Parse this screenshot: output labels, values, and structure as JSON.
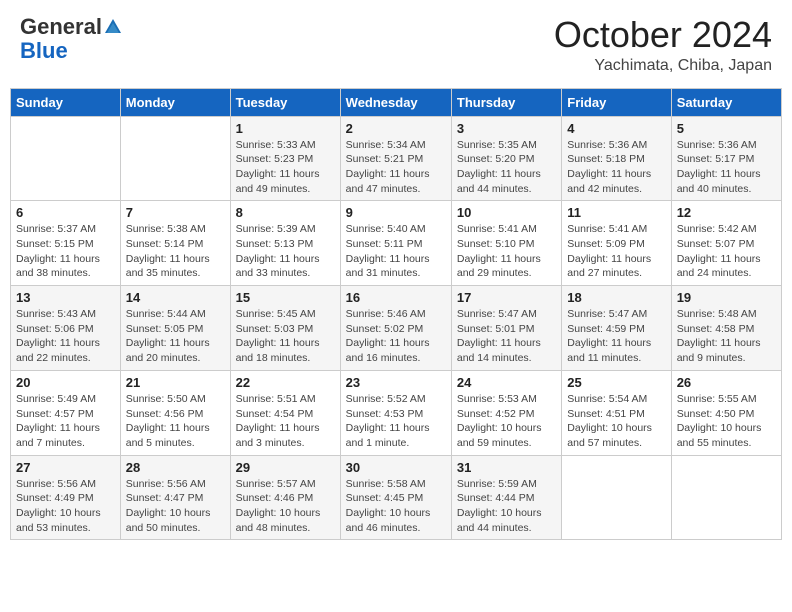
{
  "header": {
    "logo_general": "General",
    "logo_blue": "Blue",
    "month": "October 2024",
    "location": "Yachimata, Chiba, Japan"
  },
  "weekdays": [
    "Sunday",
    "Monday",
    "Tuesday",
    "Wednesday",
    "Thursday",
    "Friday",
    "Saturday"
  ],
  "weeks": [
    [
      {
        "day": "",
        "info": ""
      },
      {
        "day": "",
        "info": ""
      },
      {
        "day": "1",
        "info": "Sunrise: 5:33 AM\nSunset: 5:23 PM\nDaylight: 11 hours and 49 minutes."
      },
      {
        "day": "2",
        "info": "Sunrise: 5:34 AM\nSunset: 5:21 PM\nDaylight: 11 hours and 47 minutes."
      },
      {
        "day": "3",
        "info": "Sunrise: 5:35 AM\nSunset: 5:20 PM\nDaylight: 11 hours and 44 minutes."
      },
      {
        "day": "4",
        "info": "Sunrise: 5:36 AM\nSunset: 5:18 PM\nDaylight: 11 hours and 42 minutes."
      },
      {
        "day": "5",
        "info": "Sunrise: 5:36 AM\nSunset: 5:17 PM\nDaylight: 11 hours and 40 minutes."
      }
    ],
    [
      {
        "day": "6",
        "info": "Sunrise: 5:37 AM\nSunset: 5:15 PM\nDaylight: 11 hours and 38 minutes."
      },
      {
        "day": "7",
        "info": "Sunrise: 5:38 AM\nSunset: 5:14 PM\nDaylight: 11 hours and 35 minutes."
      },
      {
        "day": "8",
        "info": "Sunrise: 5:39 AM\nSunset: 5:13 PM\nDaylight: 11 hours and 33 minutes."
      },
      {
        "day": "9",
        "info": "Sunrise: 5:40 AM\nSunset: 5:11 PM\nDaylight: 11 hours and 31 minutes."
      },
      {
        "day": "10",
        "info": "Sunrise: 5:41 AM\nSunset: 5:10 PM\nDaylight: 11 hours and 29 minutes."
      },
      {
        "day": "11",
        "info": "Sunrise: 5:41 AM\nSunset: 5:09 PM\nDaylight: 11 hours and 27 minutes."
      },
      {
        "day": "12",
        "info": "Sunrise: 5:42 AM\nSunset: 5:07 PM\nDaylight: 11 hours and 24 minutes."
      }
    ],
    [
      {
        "day": "13",
        "info": "Sunrise: 5:43 AM\nSunset: 5:06 PM\nDaylight: 11 hours and 22 minutes."
      },
      {
        "day": "14",
        "info": "Sunrise: 5:44 AM\nSunset: 5:05 PM\nDaylight: 11 hours and 20 minutes."
      },
      {
        "day": "15",
        "info": "Sunrise: 5:45 AM\nSunset: 5:03 PM\nDaylight: 11 hours and 18 minutes."
      },
      {
        "day": "16",
        "info": "Sunrise: 5:46 AM\nSunset: 5:02 PM\nDaylight: 11 hours and 16 minutes."
      },
      {
        "day": "17",
        "info": "Sunrise: 5:47 AM\nSunset: 5:01 PM\nDaylight: 11 hours and 14 minutes."
      },
      {
        "day": "18",
        "info": "Sunrise: 5:47 AM\nSunset: 4:59 PM\nDaylight: 11 hours and 11 minutes."
      },
      {
        "day": "19",
        "info": "Sunrise: 5:48 AM\nSunset: 4:58 PM\nDaylight: 11 hours and 9 minutes."
      }
    ],
    [
      {
        "day": "20",
        "info": "Sunrise: 5:49 AM\nSunset: 4:57 PM\nDaylight: 11 hours and 7 minutes."
      },
      {
        "day": "21",
        "info": "Sunrise: 5:50 AM\nSunset: 4:56 PM\nDaylight: 11 hours and 5 minutes."
      },
      {
        "day": "22",
        "info": "Sunrise: 5:51 AM\nSunset: 4:54 PM\nDaylight: 11 hours and 3 minutes."
      },
      {
        "day": "23",
        "info": "Sunrise: 5:52 AM\nSunset: 4:53 PM\nDaylight: 11 hours and 1 minute."
      },
      {
        "day": "24",
        "info": "Sunrise: 5:53 AM\nSunset: 4:52 PM\nDaylight: 10 hours and 59 minutes."
      },
      {
        "day": "25",
        "info": "Sunrise: 5:54 AM\nSunset: 4:51 PM\nDaylight: 10 hours and 57 minutes."
      },
      {
        "day": "26",
        "info": "Sunrise: 5:55 AM\nSunset: 4:50 PM\nDaylight: 10 hours and 55 minutes."
      }
    ],
    [
      {
        "day": "27",
        "info": "Sunrise: 5:56 AM\nSunset: 4:49 PM\nDaylight: 10 hours and 53 minutes."
      },
      {
        "day": "28",
        "info": "Sunrise: 5:56 AM\nSunset: 4:47 PM\nDaylight: 10 hours and 50 minutes."
      },
      {
        "day": "29",
        "info": "Sunrise: 5:57 AM\nSunset: 4:46 PM\nDaylight: 10 hours and 48 minutes."
      },
      {
        "day": "30",
        "info": "Sunrise: 5:58 AM\nSunset: 4:45 PM\nDaylight: 10 hours and 46 minutes."
      },
      {
        "day": "31",
        "info": "Sunrise: 5:59 AM\nSunset: 4:44 PM\nDaylight: 10 hours and 44 minutes."
      },
      {
        "day": "",
        "info": ""
      },
      {
        "day": "",
        "info": ""
      }
    ]
  ]
}
